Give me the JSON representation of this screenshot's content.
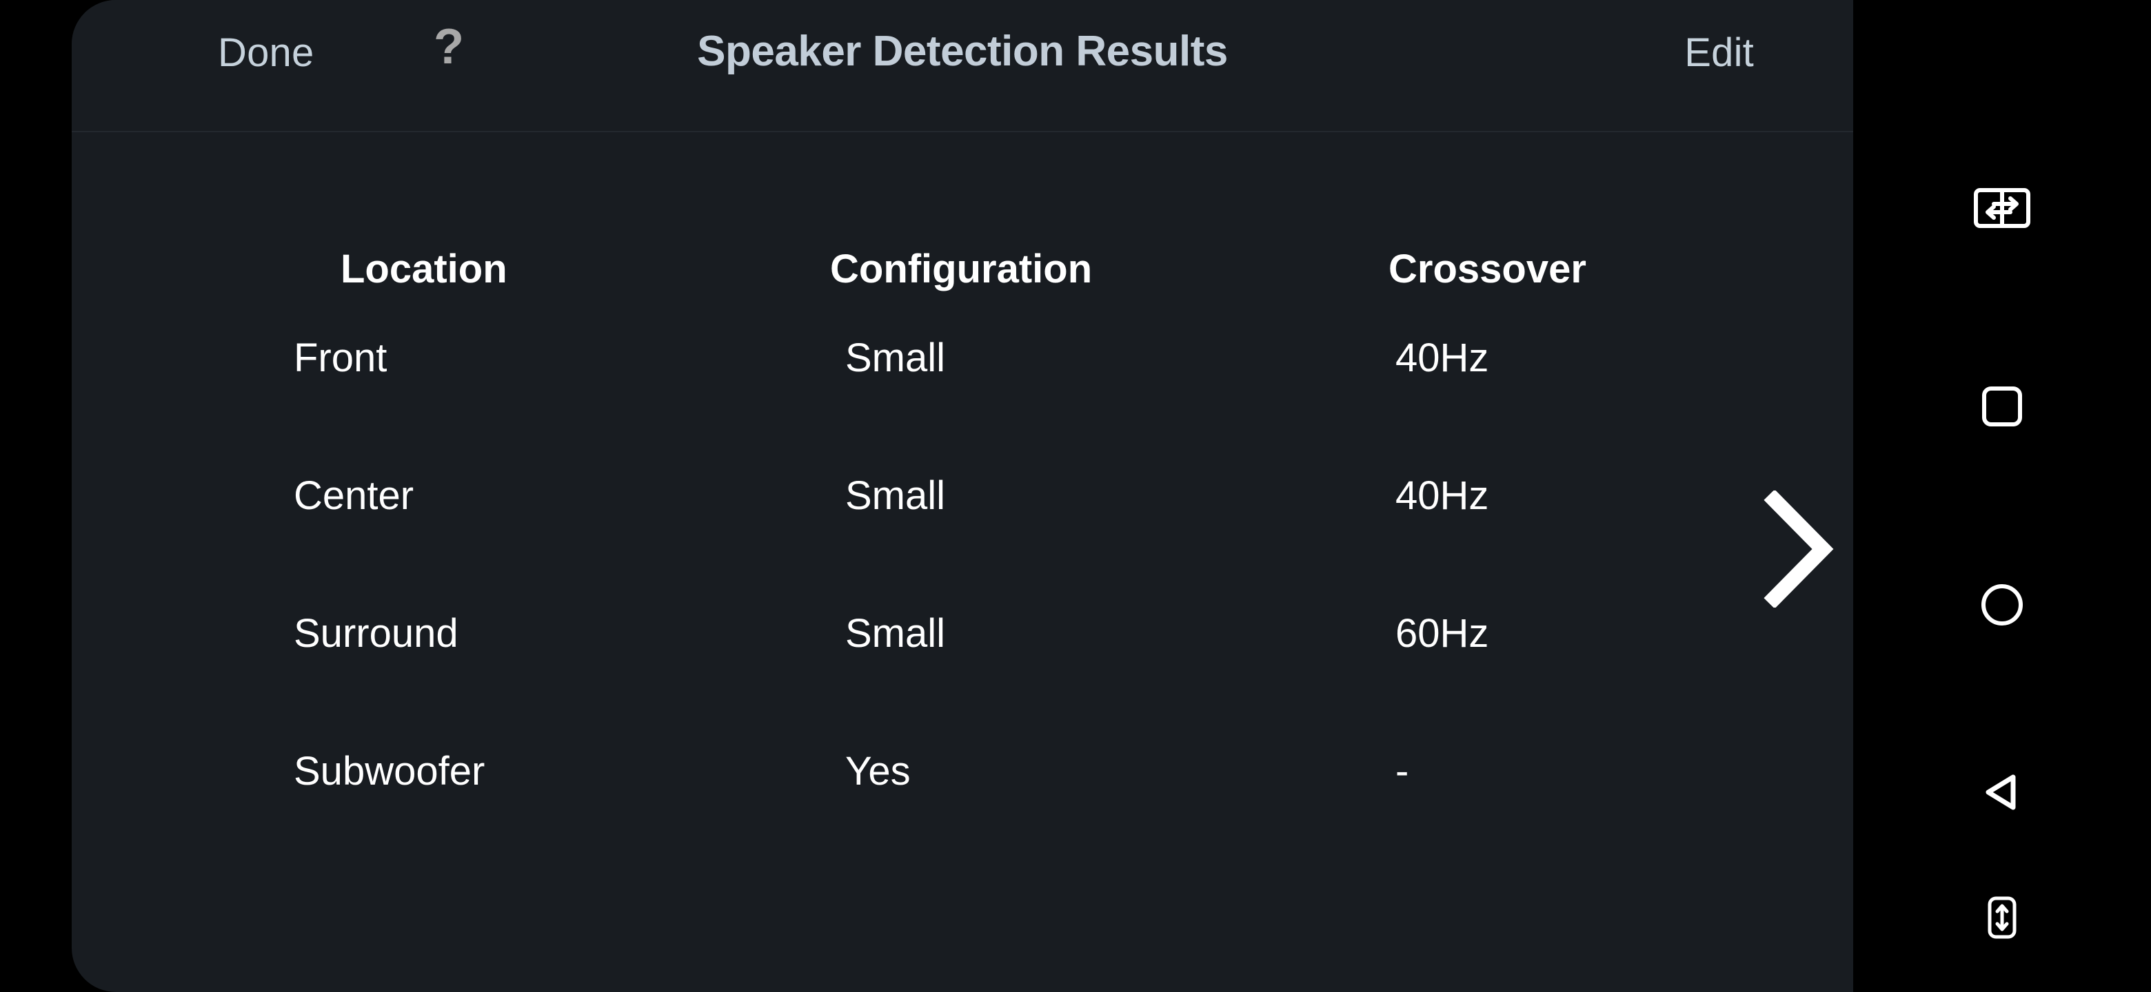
{
  "window": {
    "background_color": "#000000",
    "panel_color": "#181c21"
  },
  "navbar": {
    "done_label": "Done",
    "help_label": "?",
    "title": "Speaker Detection Results",
    "edit_label": "Edit",
    "accent_text_color": "#c6d2dc",
    "title_color": "#c2cdd8",
    "help_color": "#a8a8a8"
  },
  "table": {
    "columns": [
      "Location",
      "Configuration",
      "Crossover"
    ],
    "rows": [
      {
        "location": "Front",
        "configuration": "Small",
        "crossover": "40Hz"
      },
      {
        "location": "Center",
        "configuration": "Small",
        "crossover": "40Hz"
      },
      {
        "location": "Surround",
        "configuration": "Small",
        "crossover": "60Hz"
      },
      {
        "location": "Subwoofer",
        "configuration": "Yes",
        "crossover": "-"
      }
    ],
    "text_color": "#ffffff"
  },
  "edge_affordance": {
    "icon": "chevron-right-icon",
    "color": "#ffffff"
  },
  "system_nav": {
    "icons": [
      {
        "name": "screen-switch-icon",
        "label": "Switch screens"
      },
      {
        "name": "recents-icon",
        "label": "Recents"
      },
      {
        "name": "home-icon",
        "label": "Home"
      },
      {
        "name": "back-icon",
        "label": "Back"
      },
      {
        "name": "rotate-screen-icon",
        "label": "Rotate screen"
      }
    ],
    "color": "#ffffff",
    "background_color": "#000000"
  }
}
